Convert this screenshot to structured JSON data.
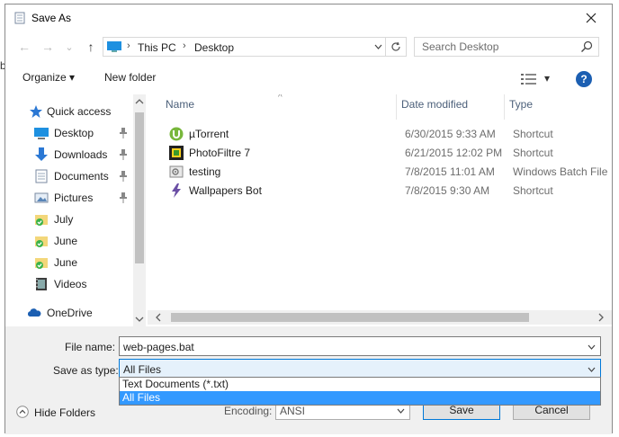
{
  "edge_fragment": "b",
  "window": {
    "title": "Save As",
    "close_symbol": "✕"
  },
  "nav": {
    "back_symbol": "←",
    "forward_symbol": "→",
    "recent_symbol": "⌄",
    "up_symbol": "↑"
  },
  "address": {
    "parts": [
      "This PC",
      "Desktop"
    ],
    "separator": "›"
  },
  "search": {
    "placeholder": "Search Desktop"
  },
  "toolbar": {
    "organize_label": "Organize ▾",
    "new_folder_label": "New folder",
    "views_dropdown": "▾",
    "help_label": "?"
  },
  "sidebar": {
    "items": [
      {
        "label": "Quick access",
        "icon": "star-icon",
        "pinned": false
      },
      {
        "label": "Desktop",
        "icon": "desktop-icon",
        "pinned": true
      },
      {
        "label": "Downloads",
        "icon": "download-icon",
        "pinned": true
      },
      {
        "label": "Documents",
        "icon": "documents-icon",
        "pinned": true
      },
      {
        "label": "Pictures",
        "icon": "pictures-icon",
        "pinned": true
      },
      {
        "label": "July",
        "icon": "folder-check-icon",
        "pinned": false
      },
      {
        "label": "June",
        "icon": "folder-check-icon",
        "pinned": false
      },
      {
        "label": "June",
        "icon": "folder-check-icon",
        "pinned": false
      },
      {
        "label": "Videos",
        "icon": "videos-icon",
        "pinned": false
      },
      {
        "label": "OneDrive",
        "icon": "cloud-icon",
        "pinned": false
      }
    ]
  },
  "columns": {
    "name": "Name",
    "date_modified": "Date modified",
    "type": "Type",
    "sort_indicator": "^"
  },
  "files": [
    {
      "name": "µTorrent",
      "date": "6/30/2015 9:33 AM",
      "type": "Shortcut",
      "icon": "utorrent-icon"
    },
    {
      "name": "PhotoFiltre 7",
      "date": "6/21/2015 12:02 PM",
      "type": "Shortcut",
      "icon": "photofiltre-icon"
    },
    {
      "name": "testing",
      "date": "7/8/2015 11:01 AM",
      "type": "Windows Batch File",
      "icon": "batch-file-icon"
    },
    {
      "name": "Wallpapers Bot",
      "date": "7/8/2015 9:30 AM",
      "type": "Shortcut",
      "icon": "wallpapers-bot-icon"
    }
  ],
  "form": {
    "file_name_label": "File name:",
    "file_name_value": "web-pages.bat",
    "save_type_label": "Save as type:",
    "save_type_value": "All Files",
    "save_type_options": [
      "Text Documents (*.txt)",
      "All Files"
    ],
    "encoding_label": "Encoding:",
    "encoding_value": "ANSI",
    "hide_folders_label": "Hide Folders",
    "save_label": "Save",
    "cancel_label": "Cancel"
  },
  "colors": {
    "accent": "#0078d7",
    "selection": "#3399ff",
    "help": "#1c5fb2"
  }
}
